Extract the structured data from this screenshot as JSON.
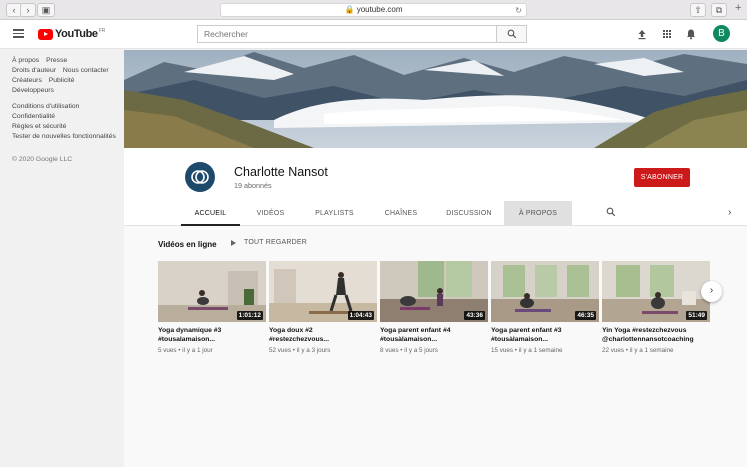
{
  "browser": {
    "url": "youtube.com"
  },
  "header": {
    "logo_text": "YouTube",
    "logo_country": "FR",
    "search_placeholder": "Rechercher",
    "avatar_letter": "B"
  },
  "sidebar": {
    "rows": [
      [
        "À propos",
        "Presse"
      ],
      [
        "Droits d'auteur",
        "Nous contacter"
      ],
      [
        "Créateurs",
        "Publicité"
      ],
      [
        "Développeurs"
      ]
    ],
    "rows2": [
      [
        "Conditions d'utilisation"
      ],
      [
        "Confidentialité"
      ],
      [
        "Règles et sécurité"
      ],
      [
        "Tester de nouvelles fonctionnalités"
      ]
    ],
    "copyright": "© 2020 Google LLC"
  },
  "channel": {
    "name": "Charlotte Nansot",
    "subscribers": "19 abonnés",
    "subscribe_label": "S'ABONNER"
  },
  "tabs": [
    {
      "label": "ACCUEIL",
      "state": "active"
    },
    {
      "label": "VIDÉOS",
      "state": ""
    },
    {
      "label": "PLAYLISTS",
      "state": ""
    },
    {
      "label": "CHAÎNES",
      "state": ""
    },
    {
      "label": "DISCUSSION",
      "state": ""
    },
    {
      "label": "À PROPOS",
      "state": "hover"
    }
  ],
  "section": {
    "title": "Vidéos en ligne",
    "play_all": "TOUT REGARDER"
  },
  "videos": [
    {
      "title1": "Yoga dynamique #3",
      "title2": "#tousalamaison...",
      "duration": "1:01:12",
      "views": "5 vues",
      "age": "il y a 1 jour"
    },
    {
      "title1": "Yoga doux #2",
      "title2": "#restezchezvous...",
      "duration": "1:04:43",
      "views": "52 vues",
      "age": "il y a 3 jours"
    },
    {
      "title1": "Yoga parent enfant #4",
      "title2": "#tousàlamaison...",
      "duration": "43:36",
      "views": "8 vues",
      "age": "il y a 5 jours"
    },
    {
      "title1": "Yoga parent enfant #3",
      "title2": "#tousàlamaison...",
      "duration": "46:35",
      "views": "15 vues",
      "age": "il y a 1 semaine"
    },
    {
      "title1": "Yin Yoga #restezchezvous",
      "title2": "@charlottennansotcoaching",
      "duration": "51:49",
      "views": "22 vues",
      "age": "il y a 1 semaine"
    }
  ]
}
